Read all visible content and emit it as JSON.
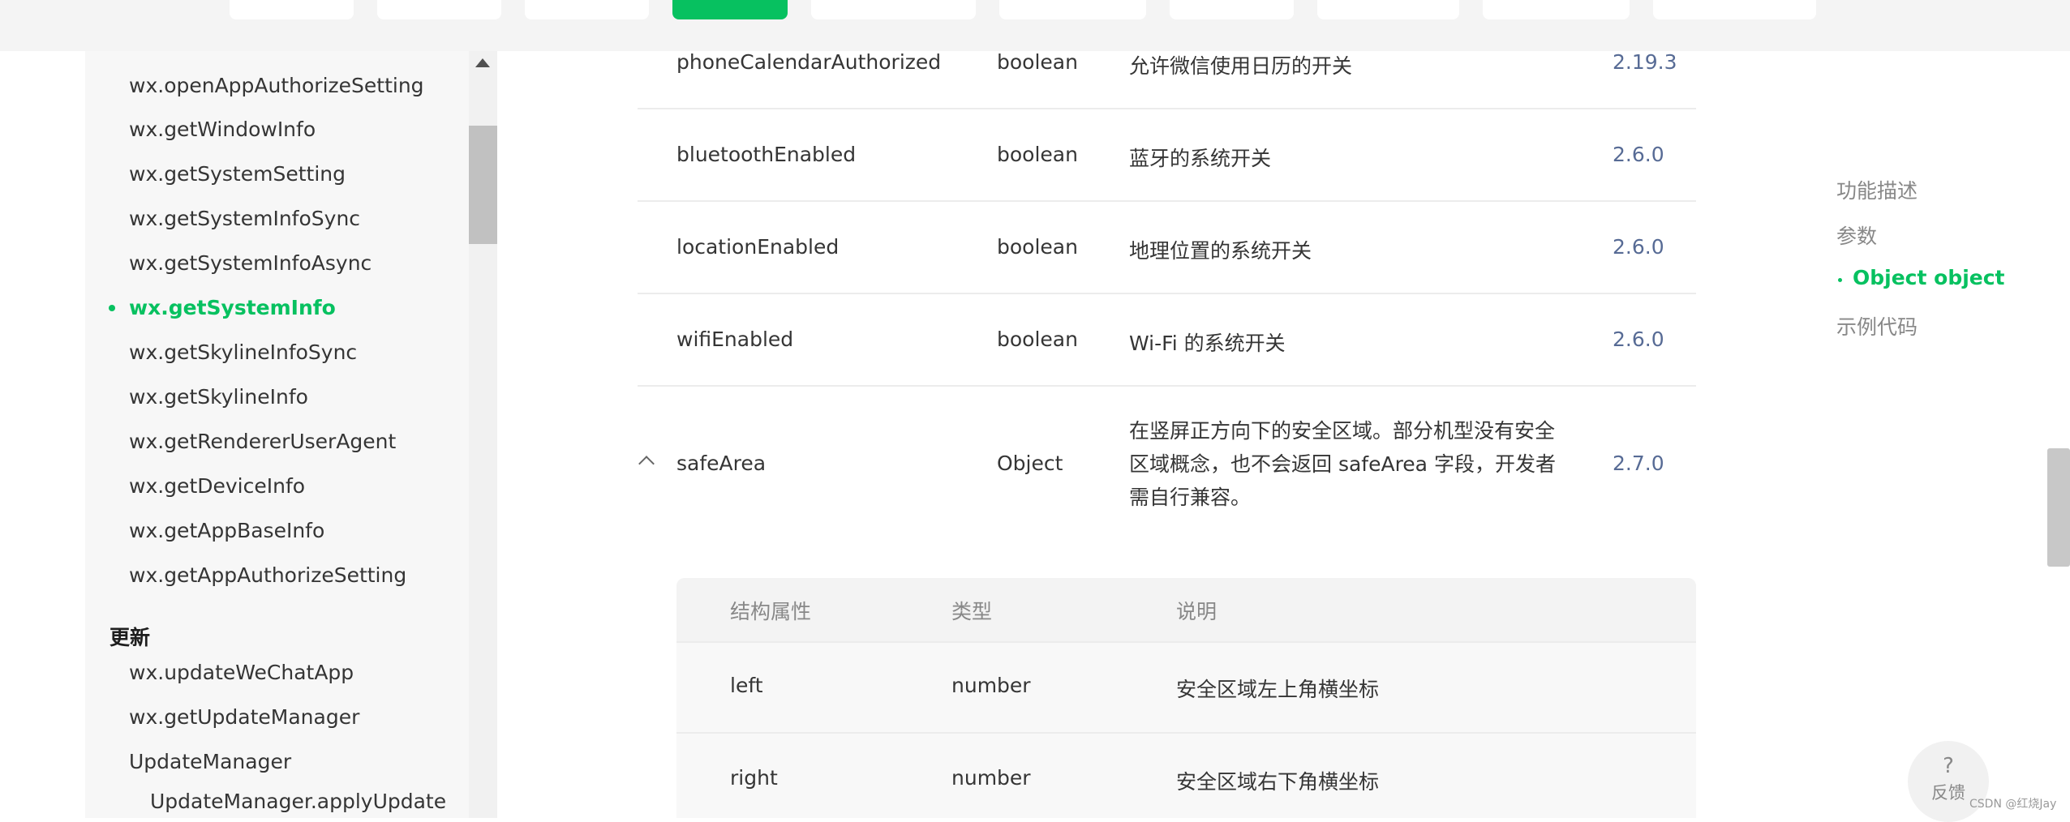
{
  "top_nav": {
    "active_index": 3,
    "tab_count": 11
  },
  "sidebar": {
    "items": [
      {
        "label": "wx.openAppAuthorizeSetting"
      },
      {
        "label": "wx.getWindowInfo"
      },
      {
        "label": "wx.getSystemSetting"
      },
      {
        "label": "wx.getSystemInfoSync"
      },
      {
        "label": "wx.getSystemInfoAsync"
      },
      {
        "label": "wx.getSystemInfo"
      },
      {
        "label": "wx.getSkylineInfoSync"
      },
      {
        "label": "wx.getSkylineInfo"
      },
      {
        "label": "wx.getRendererUserAgent"
      },
      {
        "label": "wx.getDeviceInfo"
      },
      {
        "label": "wx.getAppBaseInfo"
      },
      {
        "label": "wx.getAppAuthorizeSetting"
      }
    ],
    "active_item": "wx.getSystemInfo",
    "section_heading": "更新",
    "update_items": [
      {
        "label": "wx.updateWeChatApp"
      },
      {
        "label": "wx.getUpdateManager"
      },
      {
        "label": "UpdateManager"
      }
    ],
    "sub_item": "UpdateManager.applyUpdate"
  },
  "table": {
    "rows": [
      {
        "name": "phoneCalendarAuthorized",
        "type": "boolean",
        "desc": "允许微信使用日历的开关",
        "version": "2.19.3"
      },
      {
        "name": "bluetoothEnabled",
        "type": "boolean",
        "desc": "蓝牙的系统开关",
        "version": "2.6.0"
      },
      {
        "name": "locationEnabled",
        "type": "boolean",
        "desc": "地理位置的系统开关",
        "version": "2.6.0"
      },
      {
        "name": "wifiEnabled",
        "type": "boolean",
        "desc": "Wi-Fi 的系统开关",
        "version": "2.6.0"
      },
      {
        "name": "safeArea",
        "type": "Object",
        "desc": "在竖屏正方向下的安全区域。部分机型没有安全区域概念，也不会返回 safeArea 字段，开发者需自行兼容。",
        "version": "2.7.0"
      }
    ]
  },
  "nested_table": {
    "headers": {
      "prop": "结构属性",
      "type": "类型",
      "desc": "说明"
    },
    "rows": [
      {
        "prop": "left",
        "type": "number",
        "desc": "安全区域左上角横坐标"
      },
      {
        "prop": "right",
        "type": "number",
        "desc": "安全区域右下角横坐标"
      }
    ]
  },
  "toc": {
    "items": [
      {
        "label": "功能描述"
      },
      {
        "label": "参数"
      },
      {
        "label": "Object object"
      },
      {
        "label": "示例代码"
      }
    ],
    "active": "Object object"
  },
  "feedback": {
    "icon": "?",
    "label": "反馈"
  },
  "watermark": "CSDN @红烧Jay",
  "colors": {
    "accent": "#07c160",
    "version_link": "#576b95"
  }
}
